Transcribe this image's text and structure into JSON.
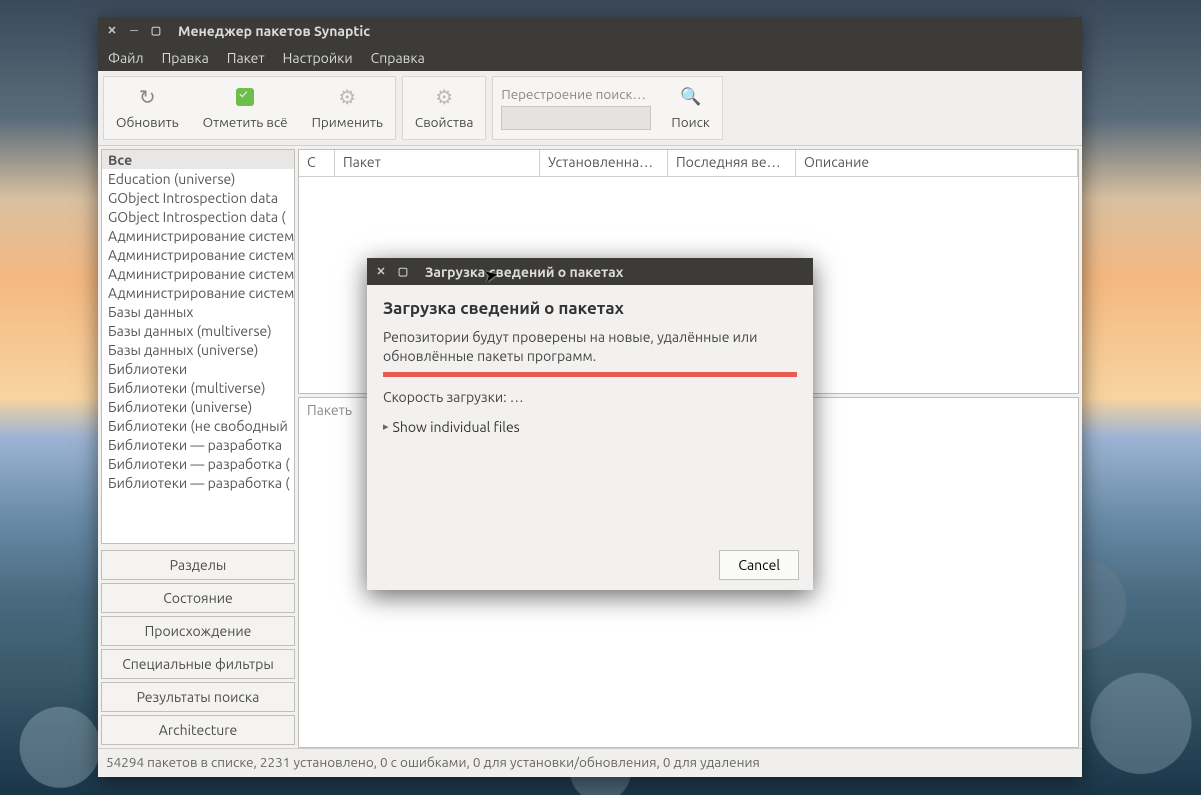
{
  "window": {
    "title": "Менеджер пакетов Synaptic"
  },
  "menu": {
    "file": "Файл",
    "edit": "Правка",
    "package": "Пакет",
    "settings": "Настройки",
    "help": "Справка"
  },
  "toolbar": {
    "reload": "Обновить",
    "mark_all": "Отметить всё",
    "apply": "Применить",
    "properties": "Свойства",
    "search_rebuild_label": "Перестроение поиск…",
    "search_placeholder": "",
    "search": "Поиск"
  },
  "categories": [
    "Все",
    "Education (universe)",
    "GObject Introspection data",
    "GObject Introspection data (",
    "Администрирование систем",
    "Администрирование систем",
    "Администрирование систем",
    "Администрирование систем",
    "Базы данных",
    "Базы данных (multiverse)",
    "Базы данных (universe)",
    "Библиотеки",
    "Библиотеки (multiverse)",
    "Библиотеки (universe)",
    "Библиотеки (не свободный",
    "Библиотеки — разработка",
    "Библиотеки — разработка (",
    "Библиотеки — разработка ("
  ],
  "filter_buttons": {
    "sections": "Разделы",
    "status": "Состояние",
    "origin": "Происхождение",
    "custom": "Специальные фильтры",
    "search_results": "Результаты поиска",
    "arch": "Architecture"
  },
  "pkg_columns": {
    "status": "С",
    "package": "Пакет",
    "installed_ver": "Установленная ве",
    "latest_ver": "Последняя верси",
    "description": "Описание"
  },
  "detail_placeholder": "Пакеть",
  "statusbar": "54294 пакетов в списке, 2231 установлено, 0 с ошибками, 0 для установки/обновления, 0 для удаления",
  "dialog": {
    "title": "Загрузка сведений о пакетах",
    "heading": "Загрузка сведений о пакетах",
    "description": "Репозитории будут проверены на новые, удалённые или обновлённые пакеты программ.",
    "speed": "Скорость загрузки: …",
    "expand": "Show individual files",
    "cancel": "Cancel"
  }
}
